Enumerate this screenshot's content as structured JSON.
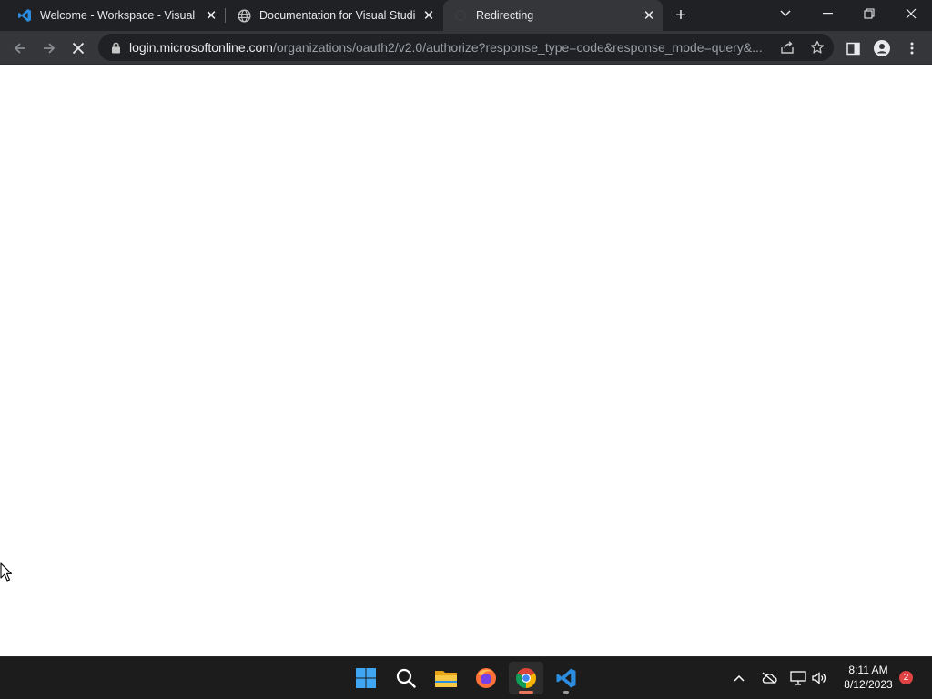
{
  "browser": {
    "tabs": [
      {
        "title": "Welcome - Workspace - Visual Studio Code",
        "icon": "vscode-icon",
        "active": false
      },
      {
        "title": "Documentation for Visual Studio Code",
        "icon": "globe-icon",
        "active": false
      },
      {
        "title": "Redirecting",
        "icon": "loading-icon",
        "active": true
      }
    ],
    "address": {
      "host": "login.microsoftonline.com",
      "path": "/organizations/oauth2/v2.0/authorize?response_type=code&response_mode=query&..."
    }
  },
  "taskbar": {
    "apps": [
      "windows-start",
      "search",
      "file-explorer",
      "firefox",
      "chrome",
      "vscode"
    ],
    "active_app": "chrome",
    "clock": {
      "time": "8:11 AM",
      "date": "8/12/2023"
    },
    "notification_count": "2"
  },
  "colors": {
    "tabstrip": "#202124",
    "toolbar": "#35363a",
    "omnibox": "#202124",
    "taskbar": "#1c1c1c",
    "accent_vscode": "#2b8de0",
    "chrome_indicator": "#e8765a"
  }
}
